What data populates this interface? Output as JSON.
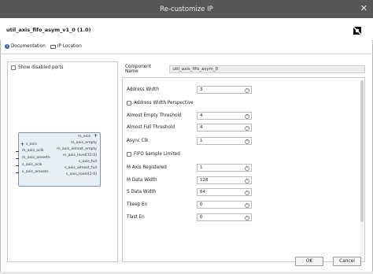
{
  "window": {
    "title": "Re-customize IP",
    "close_glyph": "✕"
  },
  "header": {
    "ip_title": "util_axis_fifo_asym_v1_0 (1.0)",
    "logo_icon": "amd-logo-icon"
  },
  "links": {
    "documentation": "Documentation",
    "ip_location": "IP Location"
  },
  "left_panel": {
    "show_disabled_ports": "Show disabled ports"
  },
  "block": {
    "right_ports_top": [
      "m_axis",
      "m_axis_empty",
      "m_axis_almost_empty",
      "m_axis_level[31:0]",
      "s_axis_full",
      "s_axis_almost_full",
      "s_axis_room[2:0]"
    ],
    "left_ports": [
      "s_axis",
      "m_axis_aclk",
      "m_axis_aresetn",
      "s_axis_aclk",
      "s_axis_aresetn"
    ]
  },
  "component": {
    "label": "Component Name",
    "value": "util_axis_fifo_asym_0"
  },
  "params": {
    "address_width": {
      "label": "Address Width",
      "value": "3"
    },
    "address_width_perspective": {
      "label": "Address Width Perspective"
    },
    "almost_empty_threshold": {
      "label": "Almost Empty Threshold",
      "value": "4"
    },
    "almost_full_threshold": {
      "label": "Almost Full Threshold",
      "value": "4"
    },
    "async_clk": {
      "label": "Async Clk",
      "value": "1"
    },
    "fifo_sample_limited": {
      "label": "FIFO Sample Limited"
    },
    "m_axis_registered": {
      "label": "M Axis Registered",
      "value": "1"
    },
    "m_data_width": {
      "label": "M Data Width",
      "value": "128"
    },
    "s_data_width": {
      "label": "S Data Width",
      "value": "64"
    },
    "tkeep_en": {
      "label": "Tkeep En",
      "value": "0"
    },
    "tlast_en": {
      "label": "Tlast En",
      "value": "0"
    }
  },
  "buttons": {
    "ok": "OK",
    "cancel": "Cancel"
  }
}
